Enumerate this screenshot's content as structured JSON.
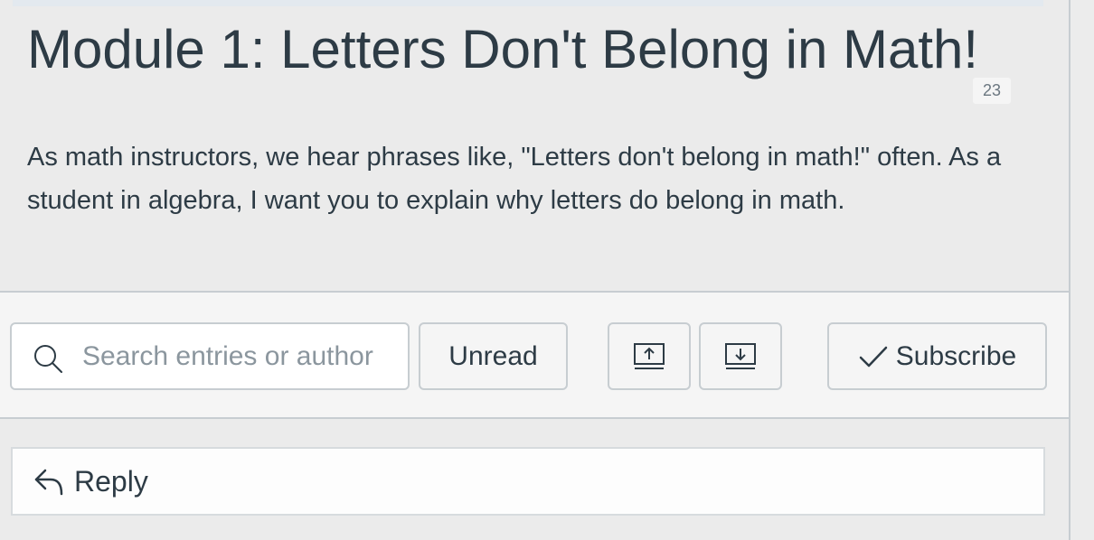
{
  "discussion": {
    "title": "Module 1: Letters Don't Belong in Math!",
    "unread_count": "23",
    "description": "As math instructors, we hear phrases like, \"Letters don't belong in math!\" often. As a student in algebra, I want you to explain why letters do belong in math."
  },
  "toolbar": {
    "search": {
      "placeholder": "Search entries or author",
      "value": "",
      "icon": "search-icon"
    },
    "unread_label": "Unread",
    "collapse_icon": "collapse-all-icon",
    "expand_icon": "expand-all-icon",
    "subscribe_label": "Subscribe",
    "subscribe_icon": "checkmark-icon"
  },
  "reply": {
    "label": "Reply",
    "icon": "reply-arrow-icon"
  },
  "colors": {
    "text": "#2d3b45",
    "border": "#c7cdd1",
    "page_background": "#ebebeb",
    "toolbar_background": "#f5f5f5"
  }
}
